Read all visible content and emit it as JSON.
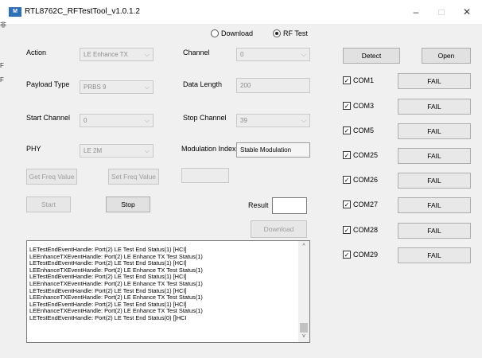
{
  "window": {
    "icon_label": "M",
    "title": "RTL8762C_RFTestTool_v1.0.1.2",
    "minimize_glyph": "–",
    "maximize_glyph": "□",
    "close_glyph": "✕"
  },
  "mode": {
    "options": [
      "Download",
      "RF Test"
    ],
    "selected": "RF Test"
  },
  "fields": {
    "action_label": "Action",
    "action_value": "LE Enhance TX",
    "channel_label": "Channel",
    "channel_value": "0",
    "payload_label": "Payload Type",
    "payload_value": "PRBS 9",
    "data_length_label": "Data Length",
    "data_length_value": "200",
    "start_channel_label": "Start Channel",
    "start_channel_value": "0",
    "stop_channel_label": "Stop Channel",
    "stop_channel_value": "39",
    "phy_label": "PHY",
    "phy_value": "LE 2M",
    "modulation_label": "Modulation Index",
    "modulation_value": "Stable Modulation",
    "freq_value": "",
    "result_label": "Result",
    "result_value": ""
  },
  "buttons": {
    "detect": "Detect",
    "open": "Open",
    "get_freq": "Get Freq Value",
    "set_freq": "Set Freq Value",
    "start": "Start",
    "stop": "Stop",
    "download": "Download"
  },
  "ports": [
    {
      "name": "COM1",
      "status": "FAIL"
    },
    {
      "name": "COM3",
      "status": "FAIL"
    },
    {
      "name": "COM5",
      "status": "FAIL"
    },
    {
      "name": "COM25",
      "status": "FAIL"
    },
    {
      "name": "COM26",
      "status": "FAIL"
    },
    {
      "name": "COM27",
      "status": "FAIL"
    },
    {
      "name": "COM28",
      "status": "FAIL"
    },
    {
      "name": "COM29",
      "status": "FAIL"
    }
  ],
  "log": [
    "LETestEndEventHandle: Port(2) LE Test End Status(1) [HCI]",
    "LEEnhanceTXEventHandle: Port(2) LE Enhance TX Test Status(1)",
    "LETestEndEventHandle: Port(2) LE Test End Status(1) [HCI]",
    "LEEnhanceTXEventHandle: Port(2) LE Enhance TX Test Status(1)",
    "LETestEndEventHandle: Port(2) LE Test End Status(1) [HCI]",
    "LEEnhanceTXEventHandle: Port(2) LE Enhance TX Test Status(1)",
    "LETestEndEventHandle: Port(2) LE Test End Status(1) [HCI]",
    "LEEnhanceTXEventHandle: Port(2) LE Enhance TX Test Status(1)",
    "LETestEndEventHandle: Port(2) LE Test End Status(1) [HCI]",
    "LEEnhanceTXEventHandle: Port(2) LE Enhance TX Test Status(1)",
    "LETestEndEventHandle: Port(2) LE Test End Status(0) []HCI"
  ],
  "checkbox_glyph": "✓",
  "combo_glyph": "⌵",
  "scroll_up_glyph": "^",
  "scroll_down_glyph": "v",
  "left_edge_marks": [
    "非",
    "F",
    "F"
  ]
}
